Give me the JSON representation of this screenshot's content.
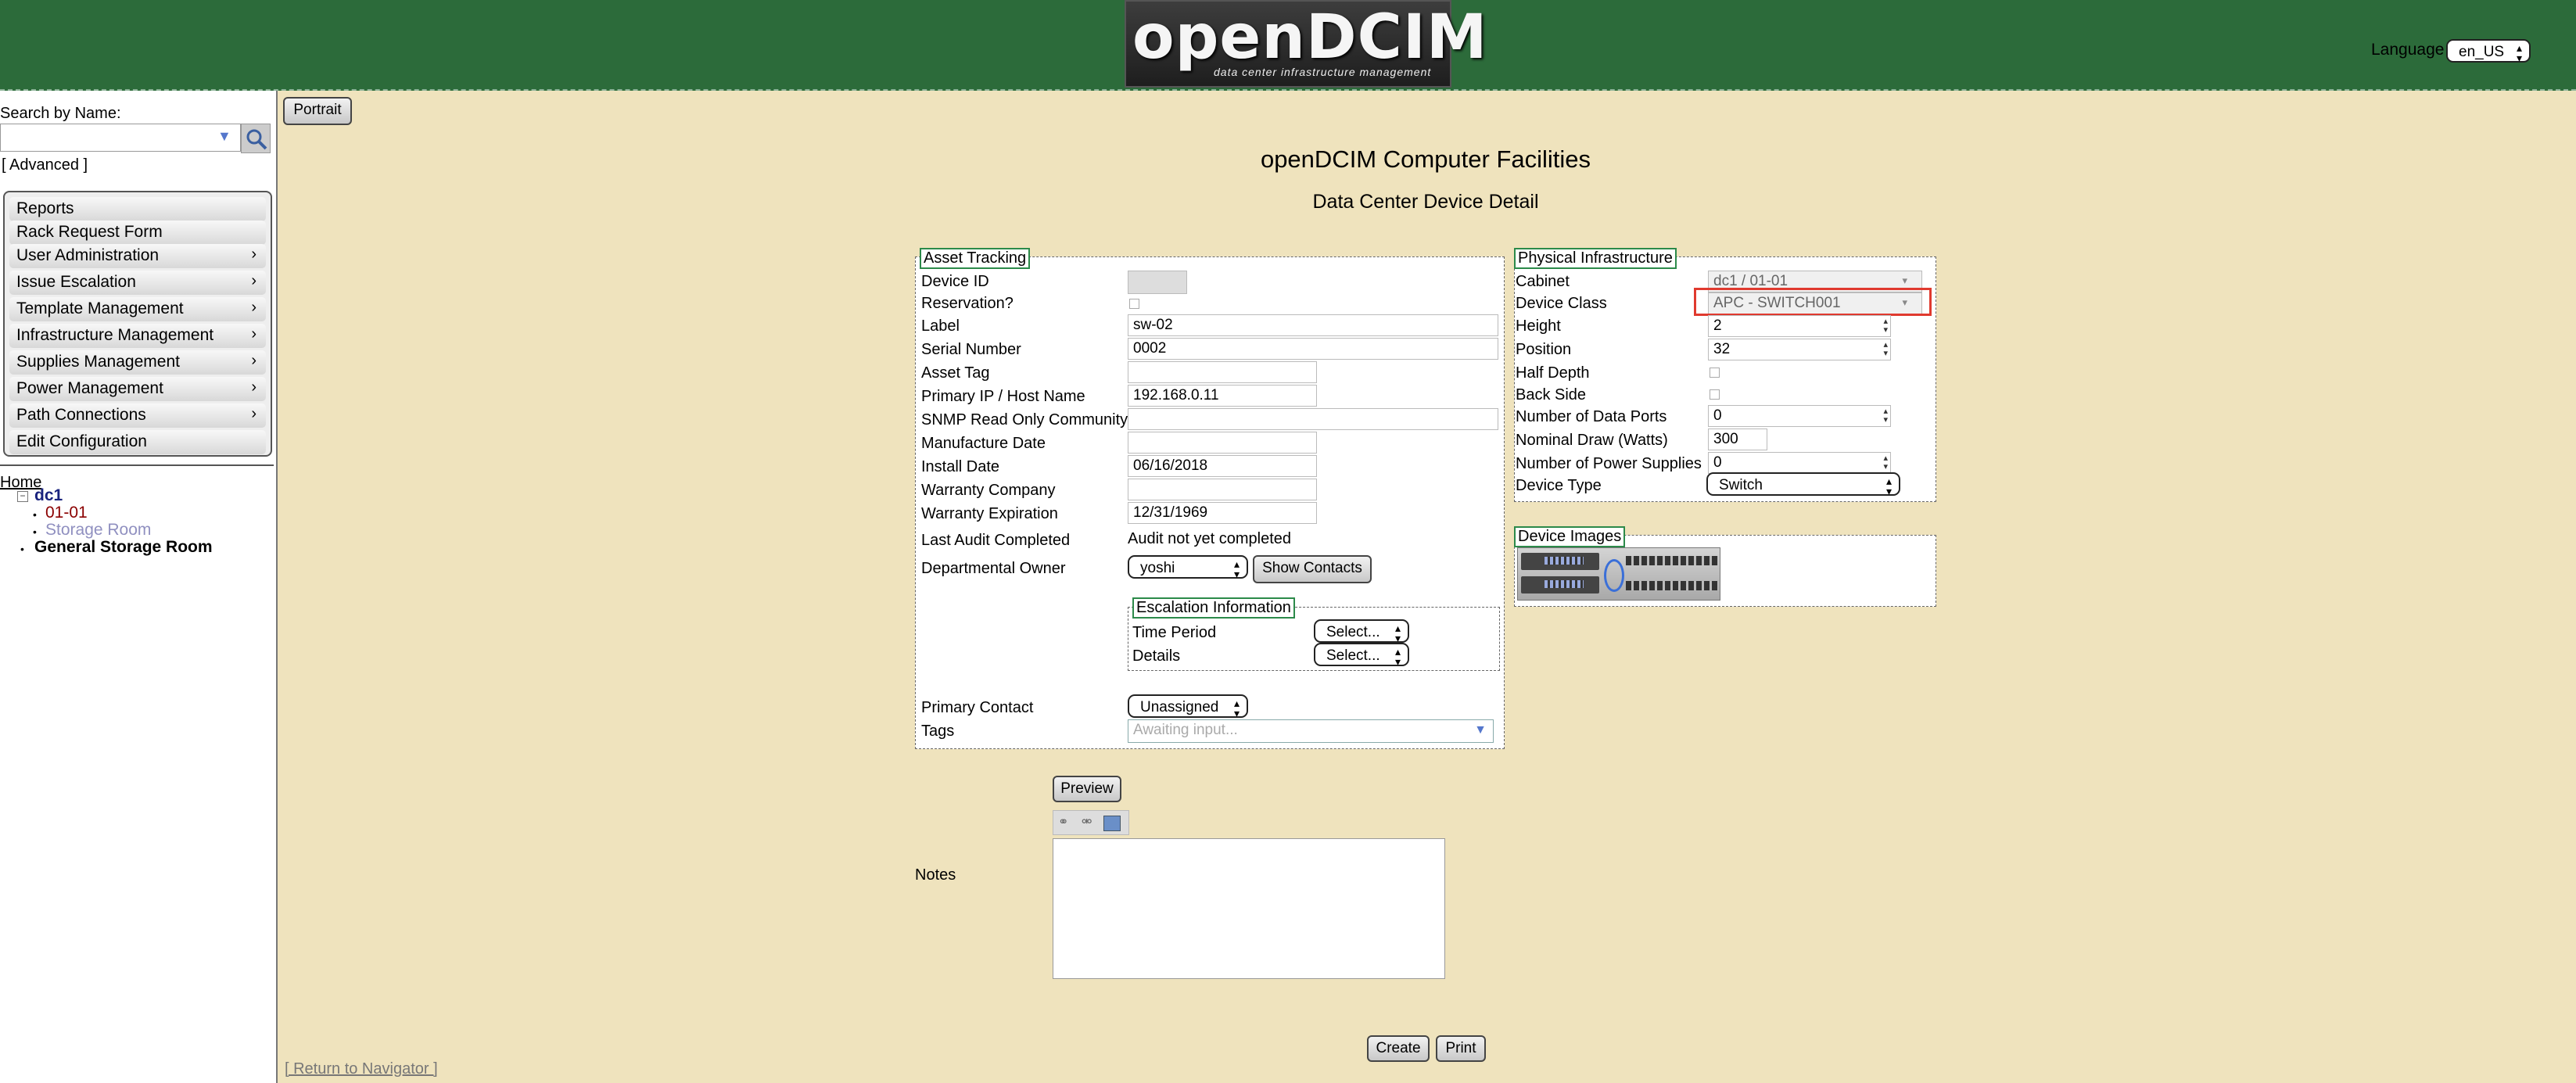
{
  "header": {
    "logo_text": "openDCIM",
    "logo_tagline": "data center infrastructure management",
    "language_label": "Language",
    "language_value": "en_US"
  },
  "sidebar": {
    "search_label": "Search by Name:",
    "search_value": "",
    "advanced_link": "[ Advanced ]",
    "menu": [
      {
        "label": "Reports",
        "submenu": false
      },
      {
        "label": "Rack Request Form",
        "submenu": false
      },
      {
        "label": "User Administration",
        "submenu": true
      },
      {
        "label": "Issue Escalation",
        "submenu": true
      },
      {
        "label": "Template Management",
        "submenu": true
      },
      {
        "label": "Infrastructure Management",
        "submenu": true
      },
      {
        "label": "Supplies Management",
        "submenu": true
      },
      {
        "label": "Power Management",
        "submenu": true
      },
      {
        "label": "Path Connections",
        "submenu": true
      },
      {
        "label": "Edit Configuration",
        "submenu": false
      }
    ],
    "tree": {
      "home": "Home",
      "toggle": "⊟",
      "dc1": "dc1",
      "cabinet": "01-01",
      "storage": "Storage Room",
      "general_storage": "General Storage Room"
    }
  },
  "main": {
    "portrait_button": "Portrait",
    "title": "openDCIM Computer Facilities",
    "subtitle": "Data Center Device Detail",
    "asset": {
      "legend": "Asset Tracking",
      "device_id_label": "Device ID",
      "device_id_value": "",
      "reservation_label": "Reservation?",
      "label_label": "Label",
      "label_value": "sw-02",
      "serial_label": "Serial Number",
      "serial_value": "0002",
      "asset_tag_label": "Asset Tag",
      "asset_tag_value": "",
      "ip_label": "Primary IP / Host Name",
      "ip_value": "192.168.0.11",
      "snmp_label": "SNMP Read Only Community",
      "snmp_value": "",
      "mfg_date_label": "Manufacture Date",
      "mfg_date_value": "",
      "install_date_label": "Install Date",
      "install_date_value": "06/16/2018",
      "warranty_company_label": "Warranty Company",
      "warranty_company_value": "",
      "warranty_exp_label": "Warranty Expiration",
      "warranty_exp_value": "12/31/1969",
      "last_audit_label": "Last Audit Completed",
      "last_audit_value": "Audit not yet completed",
      "owner_label": "Departmental Owner",
      "owner_value": "yoshi",
      "show_contacts_button": "Show Contacts",
      "escalation_legend": "Escalation Information",
      "time_period_label": "Time Period",
      "time_period_value": "Select...",
      "details_label": "Details",
      "details_value": "Select...",
      "primary_contact_label": "Primary Contact",
      "primary_contact_value": "Unassigned",
      "tags_label": "Tags",
      "tags_placeholder": "Awaiting input..."
    },
    "physical": {
      "legend": "Physical Infrastructure",
      "cabinet_label": "Cabinet",
      "cabinet_value": "dc1 / 01-01",
      "device_class_label": "Device Class",
      "device_class_value": "APC - SWITCH001",
      "height_label": "Height",
      "height_value": "2",
      "position_label": "Position",
      "position_value": "32",
      "half_depth_label": "Half Depth",
      "back_side_label": "Back Side",
      "data_ports_label": "Number of Data Ports",
      "data_ports_value": "0",
      "nominal_draw_label": "Nominal Draw (Watts)",
      "nominal_draw_value": "300",
      "power_supplies_label": "Number of Power Supplies",
      "power_supplies_value": "0",
      "device_type_label": "Device Type",
      "device_type_value": "Switch",
      "highlight_color": "#e03a2f"
    },
    "images": {
      "legend": "Device Images"
    },
    "notes_label": "Notes",
    "preview_button": "Preview",
    "create_button": "Create",
    "print_button": "Print",
    "return_link": "[ Return to Navigator ]"
  },
  "colors": {
    "header_bg": "#2c6b3a",
    "main_bg": "#efe3bd",
    "legend_border": "#2c8a4a"
  }
}
